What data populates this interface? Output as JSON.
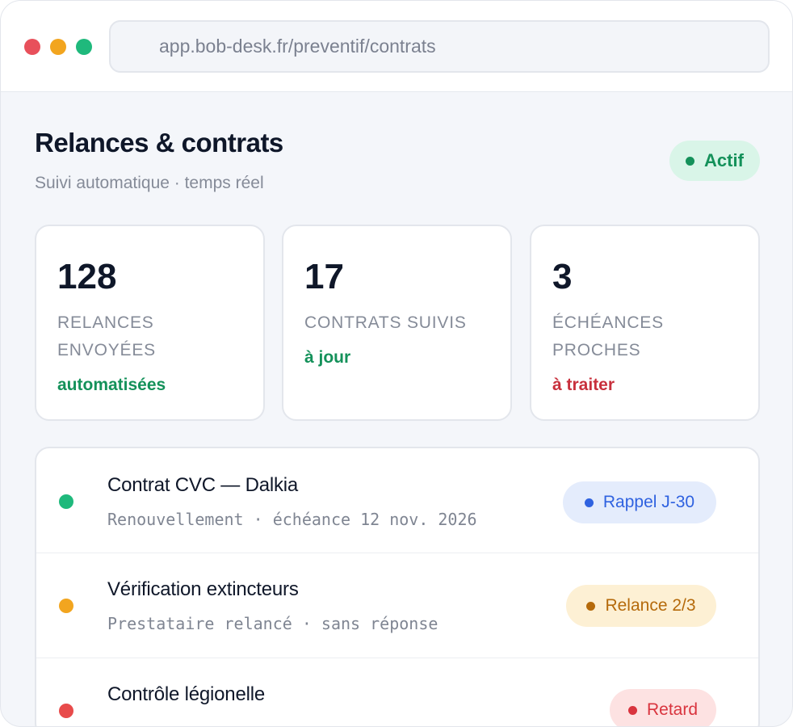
{
  "browser": {
    "url": "app.bob-desk.fr/preventif/contrats",
    "controls": {
      "close_color": "#e8505b",
      "minimize_color": "#f2a51f",
      "maximize_color": "#1fb97c"
    }
  },
  "header": {
    "title": "Relances & contrats",
    "subtitle": "Suivi automatique · temps réel",
    "status": {
      "label": "Actif",
      "color": "#14915a",
      "background": "#d9f5e8"
    }
  },
  "stats": [
    {
      "value": "128",
      "label": "RELANCES ENVOYÉES",
      "note": "automatisées",
      "note_color": "#14915a"
    },
    {
      "value": "17",
      "label": "CONTRATS SUIVIS",
      "note": "à jour",
      "note_color": "#14915a"
    },
    {
      "value": "3",
      "label": "ÉCHÉANCES PROCHES",
      "note": "à traiter",
      "note_color": "#c8303c"
    }
  ],
  "items": [
    {
      "title": "Contrat CVC — Dalkia",
      "subtitle": "Renouvellement · échéance 12 nov. 2026",
      "status_color": "#1fb97c",
      "badge": {
        "label": "Rappel J-30",
        "color": "#2f62e0",
        "background": "#e4ecfc"
      }
    },
    {
      "title": "Vérification extincteurs",
      "subtitle": "Prestataire relancé · sans réponse",
      "status_color": "#f2a51f",
      "badge": {
        "label": "Relance 2/3",
        "color": "#b56a0b",
        "background": "#fdf0d4"
      }
    },
    {
      "title": "Contrôle légionelle",
      "subtitle": "",
      "status_color": "#e84b4b",
      "badge": {
        "label": "Retard",
        "color": "#d9343e",
        "background": "#fde2e2"
      }
    }
  ]
}
